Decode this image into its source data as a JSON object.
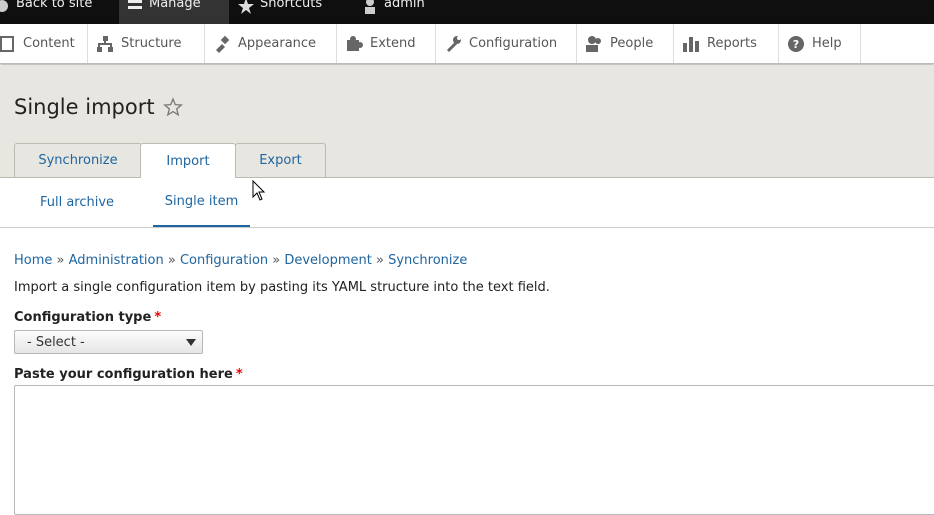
{
  "toolbar": {
    "back_to_site": "Back to site",
    "manage": "Manage",
    "shortcuts": "Shortcuts",
    "user": "admin"
  },
  "tray": {
    "items": [
      {
        "label": "Content",
        "icon": "page-icon"
      },
      {
        "label": "Structure",
        "icon": "sitemap-icon"
      },
      {
        "label": "Appearance",
        "icon": "paintbrush-icon"
      },
      {
        "label": "Extend",
        "icon": "puzzle-icon"
      },
      {
        "label": "Configuration",
        "icon": "wrench-icon"
      },
      {
        "label": "People",
        "icon": "people-icon"
      },
      {
        "label": "Reports",
        "icon": "bar-chart-icon"
      },
      {
        "label": "Help",
        "icon": "help-icon"
      }
    ]
  },
  "page": {
    "title": "Single import",
    "tabs": [
      "Synchronize",
      "Import",
      "Export"
    ],
    "subtabs": [
      "Full archive",
      "Single item"
    ]
  },
  "breadcrumb": [
    "Home",
    "Administration",
    "Configuration",
    "Development",
    "Synchronize"
  ],
  "form": {
    "description": "Import a single configuration item by pasting its YAML structure into the text field.",
    "config_type_label": "Configuration type",
    "config_type_value": "- Select -",
    "paste_label": "Paste your configuration here",
    "required_marker": "*"
  },
  "colors": {
    "link": "#1f65a0",
    "header_bg": "#e8e6e0",
    "toolbar_bg": "#0f0f0f",
    "required": "#e00000"
  }
}
